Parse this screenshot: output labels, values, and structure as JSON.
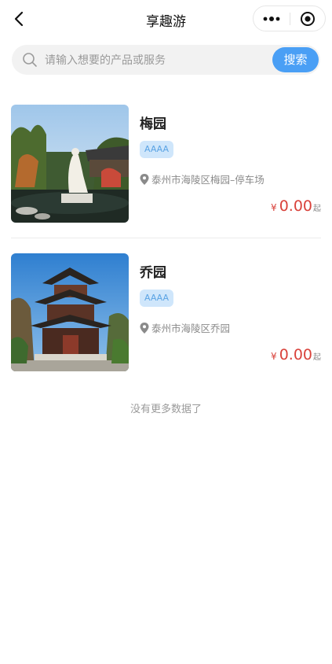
{
  "nav": {
    "title": "享趣游"
  },
  "search": {
    "placeholder": "请输入想要的产品或服务",
    "button_label": "搜索"
  },
  "items": [
    {
      "name": "梅园",
      "badge": "AAAA",
      "location": "泰州市海陵区梅园–停车场",
      "currency": "¥",
      "price": "0.00",
      "price_suffix": "起"
    },
    {
      "name": "乔园",
      "badge": "AAAA",
      "location": "泰州市海陵区乔园",
      "currency": "¥",
      "price": "0.00",
      "price_suffix": "起"
    }
  ],
  "list_end_text": "没有更多数据了",
  "colors": {
    "accent": "#4a9ff5",
    "price": "#d9423b",
    "badge_bg": "#cfe6fb",
    "badge_text": "#5aa3e4"
  }
}
